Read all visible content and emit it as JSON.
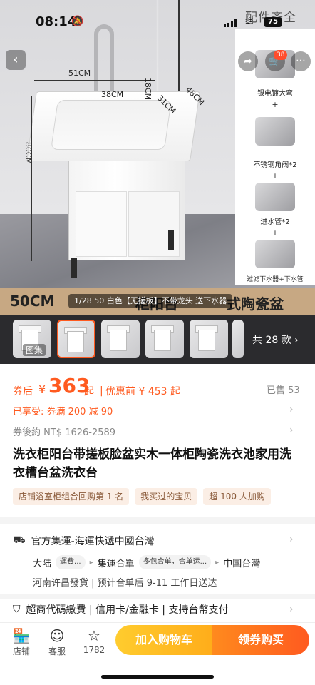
{
  "status_bar": {
    "time": "08:14",
    "battery": "75",
    "overlay_text": "配件齐全"
  },
  "hero": {
    "dimensions": {
      "width_top": "51CM",
      "basin_width": "38CM",
      "basin_depth": "18CM",
      "inner": "31CM",
      "depth": "48CM",
      "height": "80CM"
    },
    "accessories": [
      {
        "label": "银电镀大弯",
        "icon": "faucet-icon"
      },
      {
        "label": "不锈钢角阀*2",
        "icon": "valve-icon"
      },
      {
        "label": "进水管*2",
        "icon": "hose-icon"
      },
      {
        "label": "过滤下水器+下水管",
        "icon": "drain-icon"
      }
    ],
    "cart_badge": "38",
    "band_left": "50CM",
    "band_mid": "柜阳台",
    "band_right": "式陶瓷盆",
    "variant_pill": "1/28  50 白色【无搓板】不带龙头 送下水器"
  },
  "thumbnails": {
    "first_label": "图集",
    "count_text": "共 28 款 ›"
  },
  "price": {
    "pre": "券后",
    "symbol": "¥",
    "value": "363",
    "qi": "起",
    "before": "优惠前 ¥ 453 起",
    "sold": "已售 53",
    "coupon": "已享受:  券满 200 减 90",
    "ntd": "券後約 NT$ 1626-2589"
  },
  "product": {
    "title": "洗衣柜阳台带搓板脸盆实木一体柜陶瓷洗衣池家用洗衣槽台盆洗衣台",
    "tags": [
      "店铺浴室柜组合回购第 1 名",
      "我买过的宝贝",
      "超 100 人加购"
    ]
  },
  "shipping": {
    "title": "官方集運-海運快遞中國台灣",
    "route_from": "大陆",
    "route_pill1": "運費...",
    "route_mid": "集運合單",
    "route_pill2": "多包合单，合单运...",
    "route_to": "中国台灣",
    "eta": "河南许昌發貨  |  预计合单后 9-11 工作日送达"
  },
  "payment": {
    "text": "超商代碼繳費  |  信用卡/金融卡  |  支持台幣支付"
  },
  "action_bar": {
    "shop": "店铺",
    "service": "客服",
    "fav_count": "1782",
    "add_cart": "加入购物车",
    "buy": "领券购买"
  },
  "colors": {
    "accent": "#ff5a1f",
    "cart_gradient": "#ffb21a",
    "tag_bg": "#fbeee5"
  }
}
